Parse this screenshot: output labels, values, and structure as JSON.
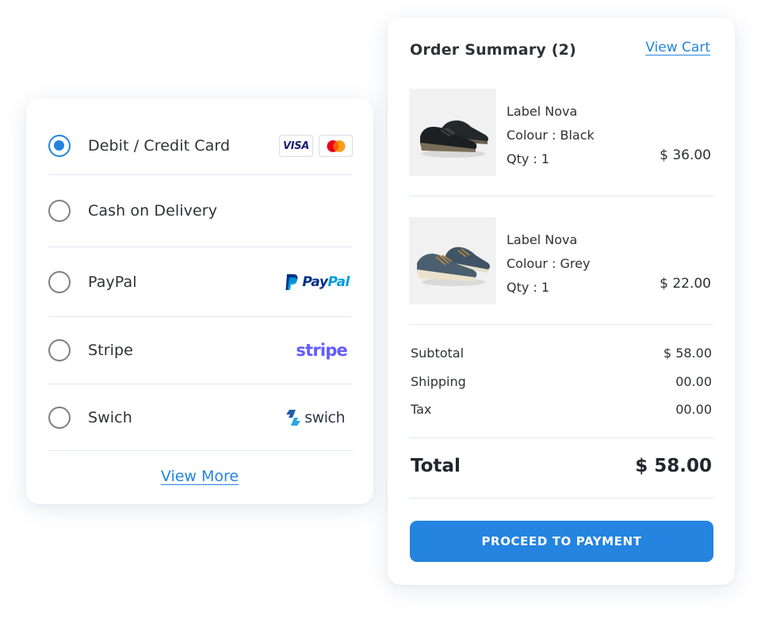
{
  "payment": {
    "methods": [
      {
        "label": "Debit / Credit Card",
        "selected": true,
        "logos": [
          "visa-icon",
          "mastercard-icon"
        ]
      },
      {
        "label": "Cash on Delivery",
        "selected": false
      },
      {
        "label": "PayPal",
        "selected": false,
        "logos": [
          "paypal-logo"
        ]
      },
      {
        "label": "Stripe",
        "selected": false,
        "logos": [
          "stripe-logo"
        ]
      },
      {
        "label": "Swich",
        "selected": false,
        "logos": [
          "swich-logo"
        ]
      }
    ],
    "visa_text": "VISA",
    "paypal_text_1": "Pay",
    "paypal_text_2": "Pal",
    "stripe_text": "stripe",
    "swich_text": "swich",
    "view_more": "View More"
  },
  "order": {
    "title": "Order Summary (2)",
    "view_cart": "View Cart",
    "items": [
      {
        "name": "Label Nova",
        "colour": "Colour : Black",
        "qty": "Qty : 1",
        "price": "$ 36.00",
        "image": "black-sneaker"
      },
      {
        "name": "Label Nova",
        "colour": "Colour : Grey",
        "qty": "Qty : 1",
        "price": "$ 22.00",
        "image": "grey-sneaker"
      }
    ],
    "subtotal_label": "Subtotal",
    "subtotal_value": "$ 58.00",
    "shipping_label": "Shipping",
    "shipping_value": "00.00",
    "tax_label": "Tax",
    "tax_value": "00.00",
    "total_label": "Total",
    "total_value": "$ 58.00",
    "proceed_label": "PROCEED TO PAYMENT"
  },
  "colors": {
    "accent": "#2484e0",
    "divider": "#dce9f5",
    "stripe": "#635bff",
    "paypal_dark": "#003087",
    "paypal_light": "#009cde"
  }
}
